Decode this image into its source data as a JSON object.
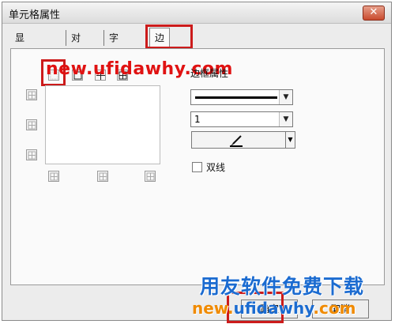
{
  "window": {
    "title": "单元格属性",
    "close_icon": "close-icon"
  },
  "tabs": [
    {
      "label": "显示格式",
      "active": false
    },
    {
      "label": "对齐",
      "active": false
    },
    {
      "label": "字体",
      "active": false
    },
    {
      "label": "边框",
      "active": true
    }
  ],
  "border_panel": {
    "watermark": "new.ufidawhy.com",
    "properties_label": "边框属性",
    "line_style": "solid",
    "line_width": "1",
    "double_line_label": "双线",
    "double_line_checked": false
  },
  "footer": {
    "watermark_title": "用友软件免费下载",
    "watermark_url_left": "new.",
    "watermark_url_mid": "ufidawhy",
    "watermark_url_right": ".com",
    "ok_label": "确定",
    "cancel_label": "取消"
  },
  "colors": {
    "highlight": "#cc1b1b",
    "watermark_red": "#e01212",
    "watermark_blue": "#1b6bd0",
    "watermark_orange": "#f08a00"
  }
}
